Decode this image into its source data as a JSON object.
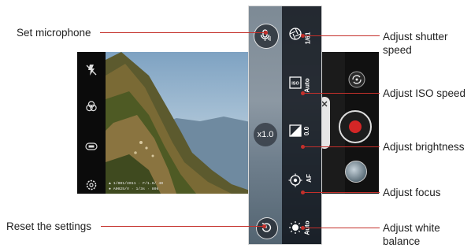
{
  "callouts": {
    "set_microphone": "Set microphone",
    "reset_settings": "Reset the settings",
    "shutter_speed": [
      "Adjust shutter",
      "speed"
    ],
    "iso_speed": "Adjust ISO speed",
    "brightness": "Adjust brightness",
    "focus": "Adjust focus",
    "white_balance": [
      "Adjust white",
      "balance"
    ]
  },
  "panel": {
    "shutter_value": "1/61",
    "iso_value": "Auto",
    "brightness_value": "0.0",
    "focus_value": "AF",
    "wb_value": "Auto",
    "zoom_label": "x1.0",
    "iso_icon_text": "ISO"
  },
  "photo_overlay": {
    "line1": "▲ 1/001/2011 · F/1.6/ 40",
    "line2": "● A0025/V · 1/3s · 80k"
  },
  "left_toolbar_icons": [
    "flash-off-icon",
    "filter-icon",
    "hdr-icon",
    "settings-icon"
  ],
  "panel_icons": [
    "microphone-icon",
    "shutter-speed-icon",
    "iso-icon",
    "brightness-icon",
    "focus-icon",
    "reset-icon",
    "white-balance-icon"
  ],
  "colors": {
    "leader_line": "#c4302b",
    "record": "#d42626"
  }
}
